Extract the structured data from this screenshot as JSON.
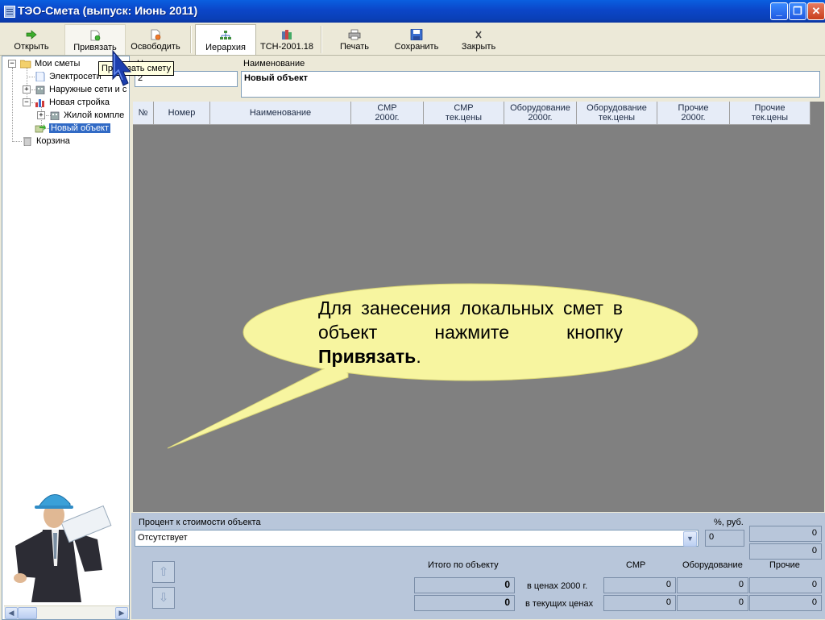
{
  "window": {
    "title": "ТЭО-Смета  (выпуск: Июнь 2011)"
  },
  "toolbar": {
    "open": "Открыть",
    "attach": "Привязать",
    "release": "Освободить",
    "hierarchy": "Иерархия",
    "tsn": "ТСН-2001.18",
    "print": "Печать",
    "save": "Сохранить",
    "close": "Закрыть"
  },
  "tooltip": "Привязать смету",
  "tree": {
    "items": [
      {
        "label": "Мои сметы"
      },
      {
        "label": "Электросети"
      },
      {
        "label": "Наружные сети и с"
      },
      {
        "label": "Новая стройка"
      },
      {
        "label": "Жилой компле"
      },
      {
        "label": "Новый объект"
      },
      {
        "label": "Корзина"
      }
    ]
  },
  "form": {
    "number_label": "Н",
    "number_value": "2",
    "name_label": "Наименование",
    "name_value": "Новый объект"
  },
  "grid": {
    "columns": [
      {
        "label": "№"
      },
      {
        "label": "Номер"
      },
      {
        "label": "Наименование"
      },
      {
        "label": "СМР\n2000г."
      },
      {
        "label": "СМР\nтек.цены"
      },
      {
        "label": "Оборудование\n2000г."
      },
      {
        "label": "Оборудование\nтек.цены"
      },
      {
        "label": "Прочие\n2000г."
      },
      {
        "label": "Прочие\nтек.цены"
      }
    ]
  },
  "callout": {
    "text_before": "Для занесения локальных смет в объект нажмите кнопку ",
    "bold": "Привязать",
    "text_after": "."
  },
  "bottom": {
    "percent_label": "Процент к стоимости объекта",
    "percent_unit": "%, руб.",
    "combo_value": "Отсутствует",
    "percent_value": "0",
    "right_value_1": "0",
    "right_value_2": "0",
    "total_label": "Итого по объекту",
    "col_smr": "СМР",
    "col_equipment": "Оборудование",
    "col_other": "Прочие",
    "row1_label": "в ценах 2000 г.",
    "row2_label": "в текущих ценах",
    "row1_total": "0",
    "row2_total": "0",
    "row1_smr": "0",
    "row1_equipment": "0",
    "row1_other": "0",
    "row2_smr": "0",
    "row2_equipment": "0",
    "row2_other": "0"
  }
}
